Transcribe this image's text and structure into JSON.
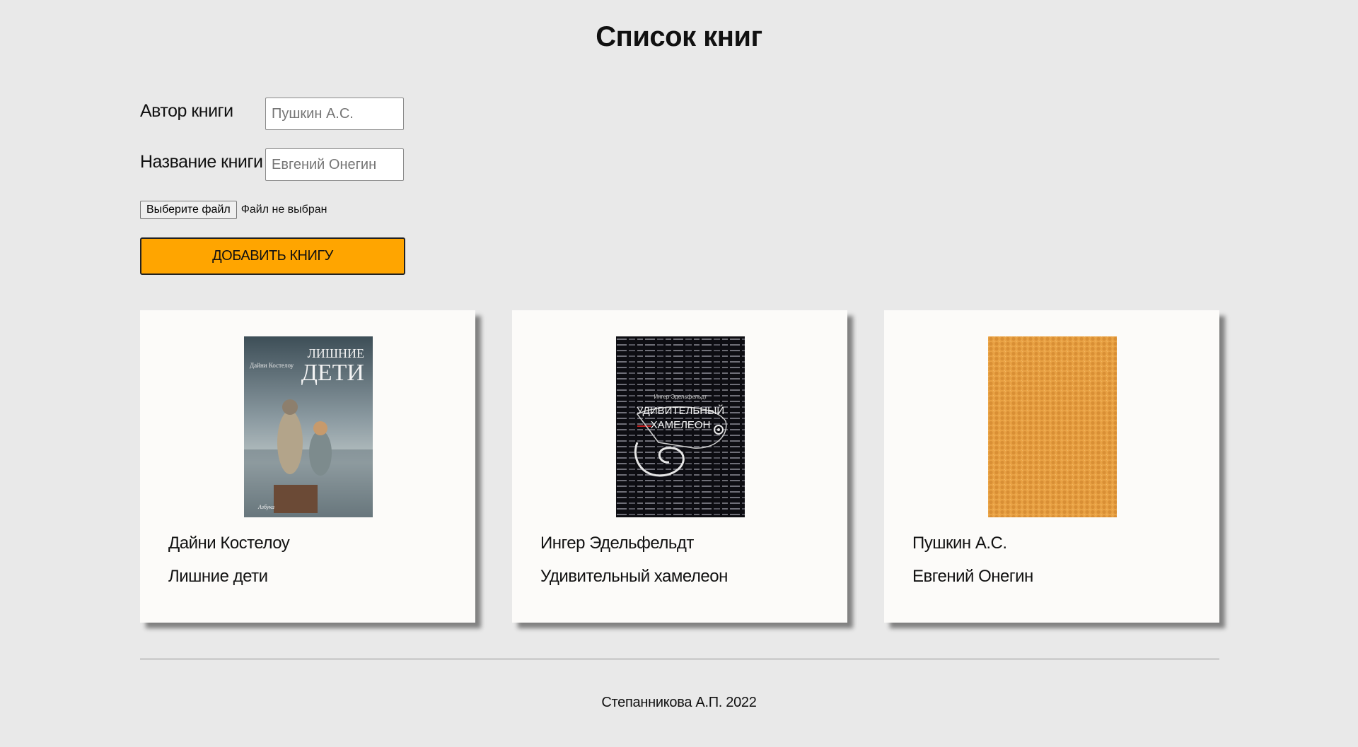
{
  "page": {
    "title": "Список книг"
  },
  "form": {
    "author_label": "Автор книги",
    "author_placeholder": "Пушкин А.С.",
    "title_label": "Название книги",
    "title_placeholder": "Евгений Онегин",
    "file_button": "Выберите файл",
    "file_status": "Файл не выбран",
    "add_button": "ДОБАВИТЬ КНИГУ",
    "add_button_color": "#ffa500"
  },
  "books": [
    {
      "author": "Дайни Костелоу",
      "title": "Лишние дети",
      "cover_text_author": "Дайни Костелоу",
      "cover_text_line1": "ЛИШНИЕ",
      "cover_text_line2": "ДЕТИ",
      "cover_brand": "Азбука"
    },
    {
      "author": "Ингер Эдельфельдт",
      "title": "Удивительный хамелеон",
      "cover_text_author": "Ингер Эдельфельдт",
      "cover_text_line1": "УДИВИТЕЛЬНЫЙ",
      "cover_text_line2": "ХАМЕЛЕОН"
    },
    {
      "author": "Пушкин А.С.",
      "title": "Евгений Онегин"
    }
  ],
  "footer": {
    "text": "Степанникова А.П. 2022"
  }
}
